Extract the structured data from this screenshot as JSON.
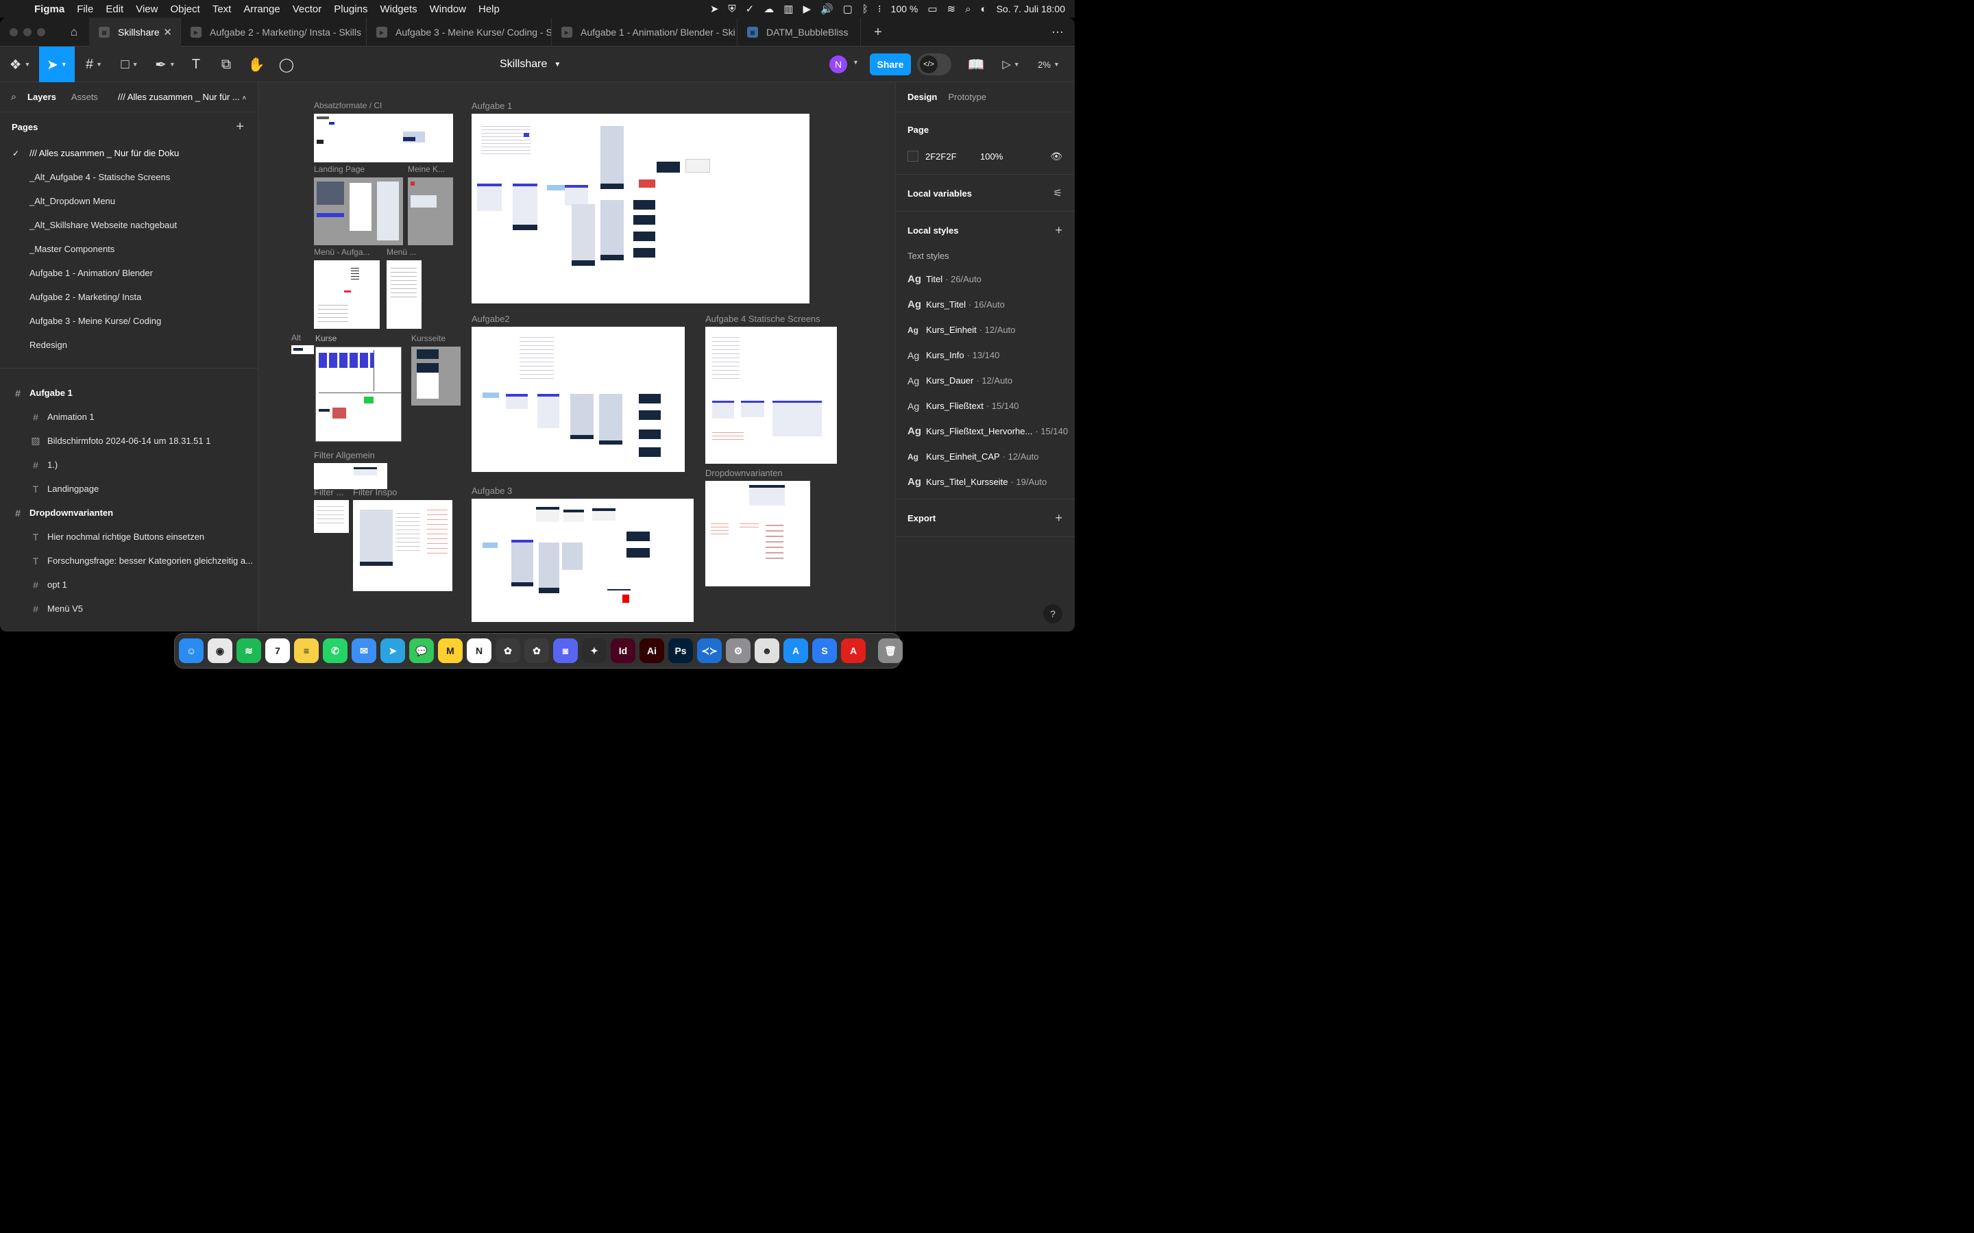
{
  "menubar": {
    "app": "Figma",
    "items": [
      "File",
      "Edit",
      "View",
      "Object",
      "Text",
      "Arrange",
      "Vector",
      "Plugins",
      "Widgets",
      "Window",
      "Help"
    ],
    "battery": "100 %",
    "datetime": "So. 7. Juli  18:00"
  },
  "tabs": [
    {
      "label": "Skillshare",
      "active": true
    },
    {
      "label": "Aufgabe 2 - Marketing/ Insta - Skills",
      "active": false
    },
    {
      "label": "Aufgabe 3 - Meine Kurse/ Coding - S",
      "active": false
    },
    {
      "label": "Aufgabe 1 - Animation/ Blender - Ski",
      "active": false
    },
    {
      "label": "DATM_BubbleBliss",
      "active": false
    }
  ],
  "toolbar": {
    "title": "Skillshare",
    "avatar_initial": "N",
    "share_label": "Share",
    "zoom": "2%"
  },
  "left_panel": {
    "tab_layers": "Layers",
    "tab_assets": "Assets",
    "current_page_short": "/// Alles zusammen _ Nur für ...",
    "pages_header": "Pages",
    "pages": [
      "/// Alles zusammen _ Nur für die Doku",
      "_Alt_Aufgabe 4 - Statische Screens",
      "_Alt_Dropdown Menu",
      "_Alt_Skillshare Webseite nachgebaut",
      "_Master Components",
      "Aufgabe 1 - Animation/ Blender",
      "Aufgabe 2 - Marketing/ Insta",
      "Aufgabe 3 - Meine Kurse/ Coding",
      "Redesign"
    ],
    "layers": [
      {
        "label": "Aufgabe 1",
        "icon": "#",
        "level": "top"
      },
      {
        "label": "Animation 1",
        "icon": "#",
        "level": "child"
      },
      {
        "label": "Bildschirmfoto 2024-06-14 um 18.31.51 1",
        "icon": "▨",
        "level": "child"
      },
      {
        "label": "1.)",
        "icon": "#",
        "level": "child"
      },
      {
        "label": "Landingpage",
        "icon": "T",
        "level": "child"
      },
      {
        "label": "Dropdownvarianten",
        "icon": "#",
        "level": "top"
      },
      {
        "label": "Hier nochmal richtige Buttons einsetzen",
        "icon": "T",
        "level": "child"
      },
      {
        "label": "Forschungsfrage: besser Kategorien gleichzeitig a...",
        "icon": "T",
        "level": "child"
      },
      {
        "label": "opt 1",
        "icon": "#",
        "level": "child"
      },
      {
        "label": "Menü V5",
        "icon": "#",
        "level": "child"
      }
    ]
  },
  "canvas": {
    "frames": [
      {
        "label": "Absatzformate / CI"
      },
      {
        "label": "Aufgabe 1"
      },
      {
        "label": "Landing Page"
      },
      {
        "label": "Meine K..."
      },
      {
        "label": "Menü - Aufga..."
      },
      {
        "label": "Menü ..."
      },
      {
        "label": "Alt"
      },
      {
        "label": "Kurse"
      },
      {
        "label": "Kursseite"
      },
      {
        "label": "Aufgabe2"
      },
      {
        "label": "Aufgabe 4 Statische Screens"
      },
      {
        "label": "Dropdownvarianten"
      },
      {
        "label": "Filter Allgemein"
      },
      {
        "label": "Filter ..."
      },
      {
        "label": "Filter Inspo"
      },
      {
        "label": "Aufgabe 3"
      }
    ]
  },
  "right_panel": {
    "tab_design": "Design",
    "tab_prototype": "Prototype",
    "page_header": "Page",
    "page_color": "2F2F2F",
    "page_opacity": "100%",
    "local_variables": "Local variables",
    "local_styles": "Local styles",
    "text_styles_label": "Text styles",
    "text_styles": [
      {
        "name": "Titel",
        "spec": "26/Auto",
        "weight": "b"
      },
      {
        "name": "Kurs_Titel",
        "spec": "16/Auto",
        "weight": "b"
      },
      {
        "name": "Kurs_Einheit",
        "spec": "12/Auto",
        "weight": "s"
      },
      {
        "name": "Kurs_Info",
        "spec": "13/140",
        "weight": "m"
      },
      {
        "name": "Kurs_Dauer",
        "spec": "12/Auto",
        "weight": "m"
      },
      {
        "name": "Kurs_Fließtext",
        "spec": "15/140",
        "weight": "m"
      },
      {
        "name": "Kurs_Fließtext_Hervorhe...",
        "spec": "15/140",
        "weight": "b"
      },
      {
        "name": "Kurs_Einheit_CAP",
        "spec": "12/Auto",
        "weight": "s"
      },
      {
        "name": "Kurs_Titel_Kursseite",
        "spec": "19/Auto",
        "weight": "b"
      }
    ],
    "export": "Export",
    "help": "?"
  },
  "dock": [
    {
      "name": "finder",
      "color": "#2a8cf0",
      "glyph": "☺"
    },
    {
      "name": "chrome",
      "color": "#e8e8e8",
      "glyph": "◉"
    },
    {
      "name": "spotify",
      "color": "#1db954",
      "glyph": "≋"
    },
    {
      "name": "calendar",
      "color": "#ffffff",
      "glyph": "7"
    },
    {
      "name": "notes",
      "color": "#f7d046",
      "glyph": "≡"
    },
    {
      "name": "whatsapp",
      "color": "#25d366",
      "glyph": "✆"
    },
    {
      "name": "mail",
      "color": "#3b8ff5",
      "glyph": "✉"
    },
    {
      "name": "telegram",
      "color": "#2aa3e0",
      "glyph": "➤"
    },
    {
      "name": "messages",
      "color": "#34c759",
      "glyph": "💬"
    },
    {
      "name": "miro",
      "color": "#ffd02f",
      "glyph": "M"
    },
    {
      "name": "notion",
      "color": "#ffffff",
      "glyph": "N"
    },
    {
      "name": "app-1",
      "color": "#3a3a3a",
      "glyph": "✿"
    },
    {
      "name": "app-2",
      "color": "#3a3a3a",
      "glyph": "✿"
    },
    {
      "name": "discord",
      "color": "#5865f2",
      "glyph": "◙"
    },
    {
      "name": "figma",
      "color": "#2c2c2c",
      "glyph": "✦"
    },
    {
      "name": "indesign",
      "color": "#49021f",
      "glyph": "Id"
    },
    {
      "name": "illustrator",
      "color": "#330000",
      "glyph": "Ai"
    },
    {
      "name": "photoshop",
      "color": "#001e36",
      "glyph": "Ps"
    },
    {
      "name": "vscode",
      "color": "#1f6fd0",
      "glyph": "≺≻"
    },
    {
      "name": "system-settings",
      "color": "#8e8e93",
      "glyph": "⚙"
    },
    {
      "name": "app-3",
      "color": "#e0e0e0",
      "glyph": "☻"
    },
    {
      "name": "app-store",
      "color": "#1c8ef9",
      "glyph": "A"
    },
    {
      "name": "app-4",
      "color": "#2a7bf4",
      "glyph": "S"
    },
    {
      "name": "acrobat",
      "color": "#e0201a",
      "glyph": "A"
    },
    {
      "name": "trash",
      "color": "#8a8a8a",
      "glyph": "🗑"
    }
  ]
}
